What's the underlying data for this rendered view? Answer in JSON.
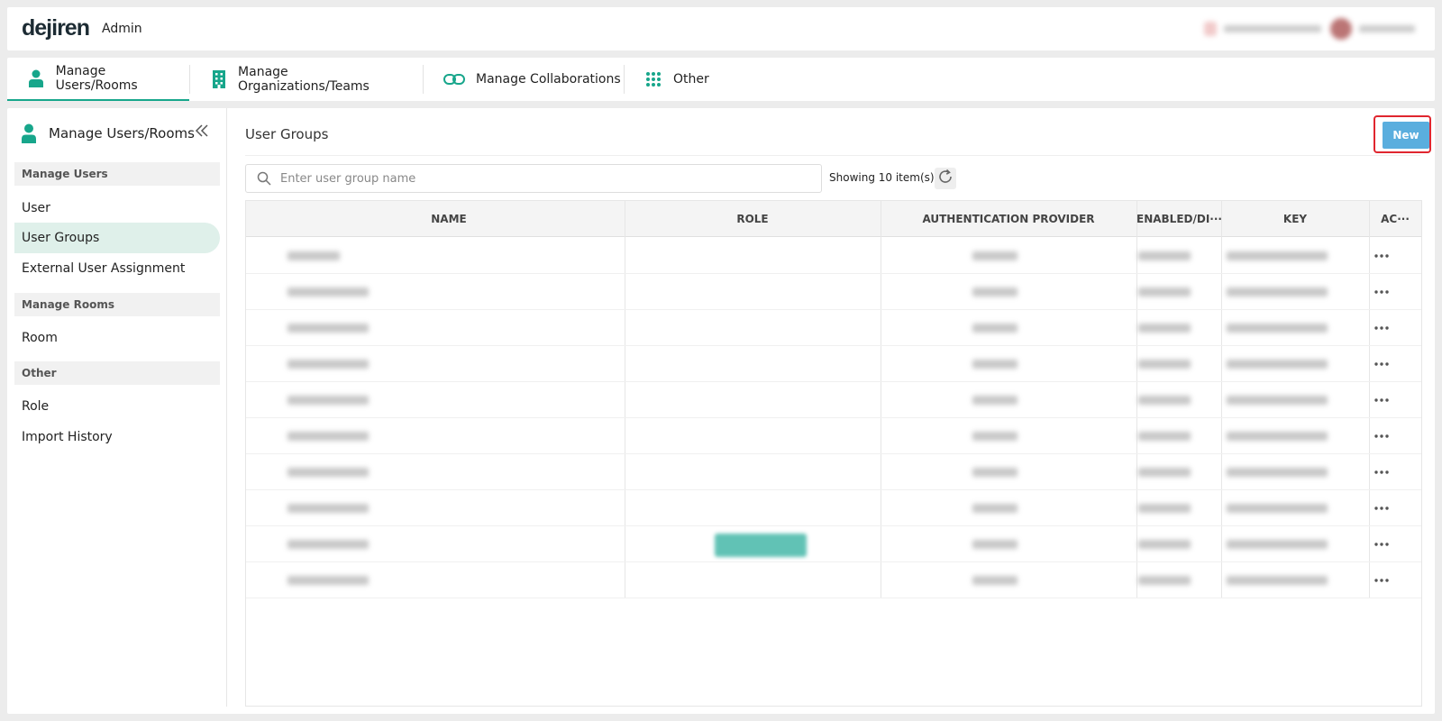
{
  "header": {
    "logo": "dejiren",
    "app_label": "Admin"
  },
  "topnav": {
    "tabs": [
      {
        "label": "Manage Users/Rooms",
        "icon": "person-icon",
        "active": true
      },
      {
        "label": "Manage Organizations/Teams",
        "icon": "building-icon",
        "active": false
      },
      {
        "label": "Manage Collaborations",
        "icon": "link-icon",
        "active": false
      },
      {
        "label": "Other",
        "icon": "grid-dots-icon",
        "active": false
      }
    ]
  },
  "sidebar": {
    "title": "Manage Users/Rooms",
    "sections": [
      {
        "label": "Manage Users"
      },
      {
        "label": "Manage Rooms"
      },
      {
        "label": "Other"
      }
    ],
    "items": [
      {
        "label": "User",
        "active": false
      },
      {
        "label": "User Groups",
        "active": true
      },
      {
        "label": "External User Assignment",
        "active": false
      },
      {
        "label": "Room",
        "active": false
      },
      {
        "label": "Role",
        "active": false
      },
      {
        "label": "Import History",
        "active": false
      }
    ]
  },
  "content": {
    "title": "User Groups",
    "new_button": "New",
    "search_placeholder": "Enter user group name",
    "showing": "Showing 10 item(s)",
    "columns": [
      "NAME",
      "ROLE",
      "AUTHENTICATION PROVIDER",
      "ENABLED/DI···",
      "KEY",
      "AC···"
    ],
    "row_count": 10,
    "row_action_icon": "more-horizontal-icon"
  },
  "colors": {
    "accent": "#17a68b",
    "new_button": "#5aaede",
    "highlight_frame": "#e0262f",
    "active_item_bg": "#dff0ea"
  }
}
